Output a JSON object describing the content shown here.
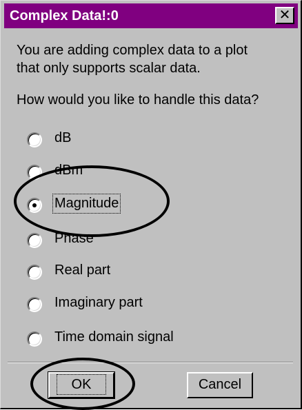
{
  "dialog": {
    "title": "Complex Data!:0",
    "close_glyph": "✕",
    "message_line1": "You are adding complex data to a plot",
    "message_line2": "that only supports scalar data.",
    "question": "How would you like to handle this data?",
    "selected": "Magnitude",
    "options": [
      "dB",
      "dBm",
      "Magnitude",
      "Phase",
      "Real part",
      "Imaginary part",
      "Time domain signal"
    ]
  },
  "buttons": {
    "ok": "OK",
    "cancel": "Cancel"
  },
  "colors": {
    "titlebar": "#800080",
    "face": "#c0c0c0"
  }
}
